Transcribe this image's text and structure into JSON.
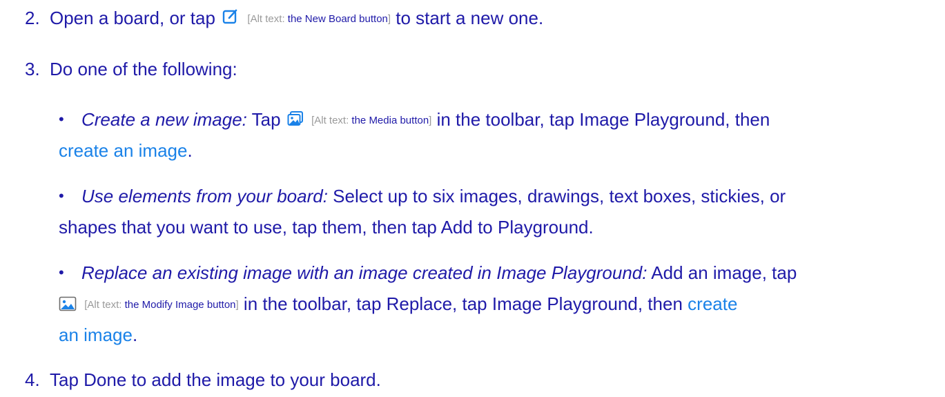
{
  "steps": [
    {
      "number": "2.",
      "text_before": "Open a board, or tap",
      "icon": "new-board-icon",
      "alt_prefix": "[Alt text: ",
      "alt_value": "the New Board button",
      "alt_suffix": "]",
      "text_after": " to start a new one."
    },
    {
      "number": "3.",
      "text": "Do one of the following:"
    },
    {
      "number": "4.",
      "text": "Tap Done to add the image to your board."
    }
  ],
  "bullets": [
    {
      "label": "Create a new image:",
      "text_before": " Tap",
      "icon": "media-icon",
      "alt_prefix": "[Alt text: ",
      "alt_value": "the Media button",
      "alt_suffix": "]",
      "text_after": " in the toolbar, tap Image Playground, then",
      "link": "create an image",
      "text_end": "."
    },
    {
      "label": "Use elements from your board:",
      "line1": " Select up to six images, drawings, text boxes, stickies, or",
      "line2": "shapes that you want to use, tap them, then tap Add to Playground."
    },
    {
      "label": "Replace an existing image with an image created in Image Playground:",
      "text_line1": " Add an image, tap",
      "icon": "modify-image-icon",
      "alt_prefix": "[Alt text: ",
      "alt_value": "the Modify Image button",
      "alt_suffix": "]",
      "text_line2": " in the toolbar, tap Replace, tap Image Playground, then",
      "link_part1": "create",
      "link_part2": "an image",
      "text_end": "."
    }
  ],
  "colors": {
    "text": "#1f1aa8",
    "link": "#1a82e8",
    "alt_text": "#9a9a9a",
    "icon": "#1a82e8"
  }
}
